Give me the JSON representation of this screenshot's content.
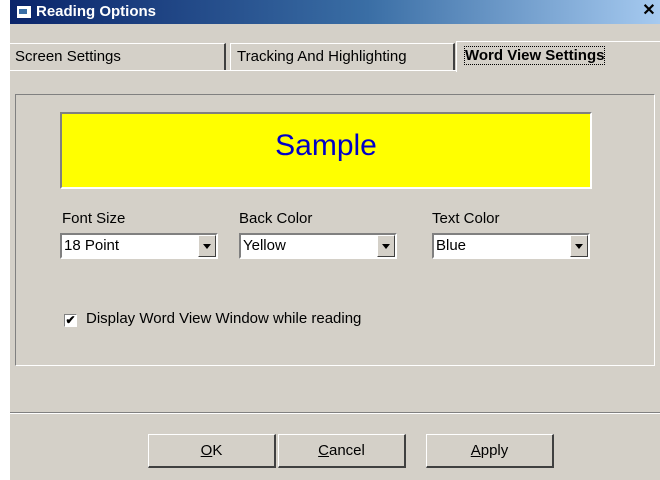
{
  "window": {
    "title": "Reading Options",
    "close_glyph": "✕"
  },
  "tabs": [
    {
      "label": "Screen Settings",
      "active": false
    },
    {
      "label": "Tracking And Highlighting",
      "active": false
    },
    {
      "label": "Word View Settings",
      "active": true
    }
  ],
  "sample": {
    "text": "Sample",
    "background": "#ffff00",
    "text_color": "#0000c8"
  },
  "fields": {
    "font_size": {
      "label": "Font Size",
      "value": "18 Point"
    },
    "back_color": {
      "label": "Back Color",
      "value": "Yellow"
    },
    "text_color": {
      "label": "Text Color",
      "value": "Blue"
    }
  },
  "display_word_view": {
    "label": "Display Word View Window while reading",
    "checked": true,
    "mark": "✔"
  },
  "buttons": {
    "ok": {
      "underlined": "O",
      "rest": "K"
    },
    "cancel": {
      "underlined": "C",
      "rest": "ancel"
    },
    "apply": {
      "underlined": "A",
      "rest": "pply"
    }
  }
}
